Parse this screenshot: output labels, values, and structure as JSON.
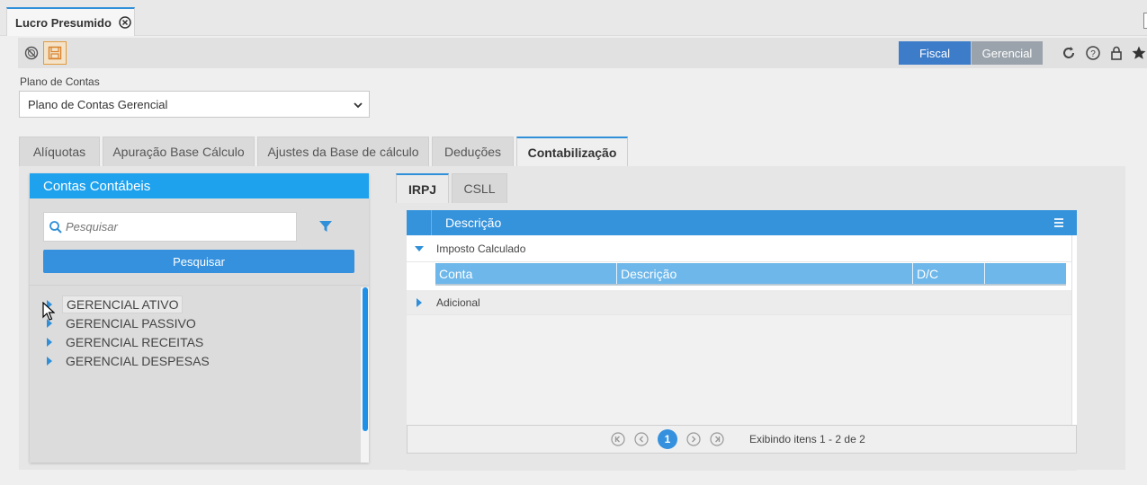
{
  "document_tab": {
    "label": "Lucro Presumido",
    "close_icon": "close-circle-icon"
  },
  "toolbar": {
    "cancel_icon": "cancel-icon",
    "save_icon": "save-icon",
    "mode_fiscal": "Fiscal",
    "mode_gerencial": "Gerencial",
    "selected_mode": "Fiscal",
    "icons": [
      "refresh-icon",
      "help-icon",
      "lock-icon",
      "star-icon"
    ]
  },
  "plano": {
    "label": "Plano de Contas",
    "selected": "Plano de Contas Gerencial"
  },
  "main_tabs": [
    {
      "label": "Alíquotas"
    },
    {
      "label": "Apuração Base Cálculo"
    },
    {
      "label": "Ajustes da Base de cálculo"
    },
    {
      "label": "Deduções"
    },
    {
      "label": "Contabilização"
    }
  ],
  "active_main_tab": "Contabilização",
  "left_panel": {
    "title": "Contas Contábeis",
    "search_placeholder": "Pesquisar",
    "search_button": "Pesquisar",
    "tree": [
      {
        "label": "GERENCIAL ATIVO"
      },
      {
        "label": "GERENCIAL PASSIVO"
      },
      {
        "label": "GERENCIAL RECEITAS"
      },
      {
        "label": "GERENCIAL DESPESAS"
      }
    ]
  },
  "sub_tabs": [
    {
      "label": "IRPJ"
    },
    {
      "label": "CSLL"
    }
  ],
  "active_sub_tab": "IRPJ",
  "grid": {
    "header": "Descrição",
    "groups": [
      {
        "label": "Imposto Calculado",
        "expanded": true
      },
      {
        "label": "Adicional",
        "expanded": false
      }
    ],
    "detail_columns": [
      "Conta",
      "Descrição",
      "D/C",
      ""
    ],
    "pager": {
      "current_page": "1",
      "info": "Exibindo itens 1 - 2 de 2"
    }
  },
  "colors": {
    "accent": "#1ea2ee",
    "button": "#3591de",
    "fiscal": "#3d7cc9",
    "save_highlight": "#e29b3b"
  }
}
